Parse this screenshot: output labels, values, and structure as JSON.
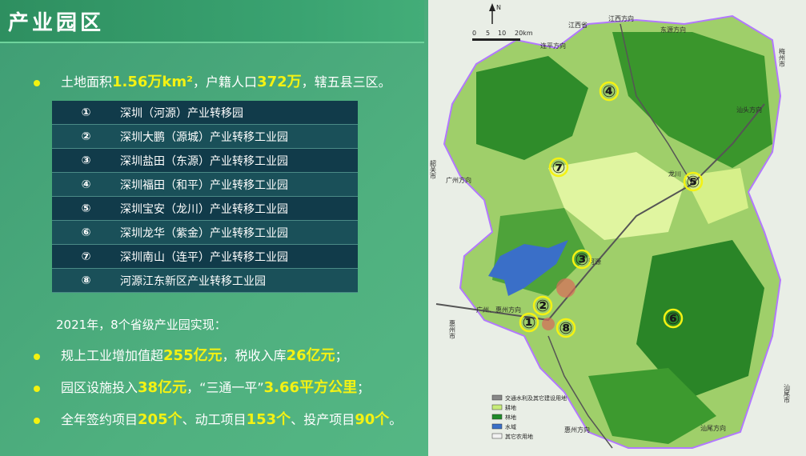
{
  "title": "产业园区",
  "colors": {
    "highlight": "#f4f213",
    "table_dark": "#113b4a",
    "table_light": "#1a5059",
    "bg": "#4fb07f"
  },
  "summary": {
    "p1": "土地面积",
    "v1": "1.56万km²",
    "p2": "，户籍人口",
    "v2": "372万",
    "p3": "，辖五县三区。"
  },
  "parks": [
    {
      "num": "①",
      "name": "深圳（河源）产业转移园"
    },
    {
      "num": "②",
      "name": "深圳大鹏（源城）产业转移工业园"
    },
    {
      "num": "③",
      "name": "深圳盐田（东源）产业转移工业园"
    },
    {
      "num": "④",
      "name": "深圳福田（和平）产业转移工业园"
    },
    {
      "num": "⑤",
      "name": "深圳宝安（龙川）产业转移工业园"
    },
    {
      "num": "⑥",
      "name": "深圳龙华（紫金）产业转移工业园"
    },
    {
      "num": "⑦",
      "name": "深圳南山（连平）产业转移工业园"
    },
    {
      "num": "⑧",
      "name": "河源江东新区产业转移工业园"
    }
  ],
  "achievements_intro": "2021年，8个省级产业园实现：",
  "achievements": [
    {
      "a": "规上工业增加值超",
      "b": "255亿元",
      "c": "，税收入库",
      "d": "26亿元",
      "e": "；"
    },
    {
      "a": "园区设施投入",
      "b": "38亿元",
      "c": "，“三通一平”",
      "d": "3.66平方公里",
      "e": "；"
    },
    {
      "a": "全年签约项目",
      "b": "205个",
      "c": "、动工项目",
      "d": "153个",
      "e": "、投产项目",
      "f": "90个",
      "g": "。"
    }
  ],
  "map": {
    "labels": {
      "jiangxi": "江西省",
      "meizhou": "梅州市",
      "shaoguan": "韶关市",
      "guangzhou_dir": "广州方向",
      "huizhou": "惠州市",
      "shanwei": "汕尾市",
      "scale_0": "0",
      "scale_5": "5",
      "scale_10": "10",
      "scale_20": "20km",
      "north": "N",
      "dongyuan": "东源方向",
      "lianping": "连平方向",
      "jiangxi_dir": "江西方向",
      "longchuan": "龙川",
      "hejin": "河源",
      "shantou": "汕头方向",
      "huizhou_dir": "惠州方向",
      "shanwei_dir": "汕尾方向",
      "guangzhou_hui": "广州、惠州方向"
    },
    "markers": [
      "①",
      "②",
      "③",
      "④",
      "⑤",
      "⑥",
      "⑦",
      "⑧"
    ],
    "legend": [
      {
        "label": "交通水利及其它建设用地",
        "color": "#888888"
      },
      {
        "label": "耕地",
        "color": "#c8ec7a"
      },
      {
        "label": "林地",
        "color": "#1f8a2a"
      },
      {
        "label": "水域",
        "color": "#3a6fc8"
      },
      {
        "label": "其它农用地",
        "color": "#f2f2f2"
      }
    ]
  }
}
